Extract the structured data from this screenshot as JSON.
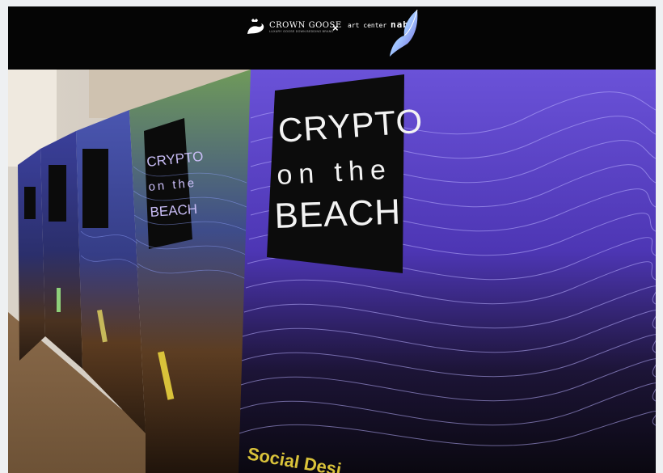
{
  "header": {
    "brand_left": "CROWN GOOSE",
    "brand_left_tagline": "LUXURY GOOSE DOWN BEDDING BRAND",
    "separator": "×",
    "brand_right_prefix": "art center",
    "brand_right_name": "nabi"
  },
  "poster": {
    "line1": "CRYPTO",
    "line2": "on the",
    "line3": "BEACH",
    "footer_text": "Social Desi"
  },
  "colors": {
    "header_bg": "#050505",
    "poster_purple": "#5a3fd0",
    "poster_sign_bg": "#0c0c0c",
    "poster_text": "#f3f3f3",
    "accent_yellow": "#d9c23a"
  }
}
